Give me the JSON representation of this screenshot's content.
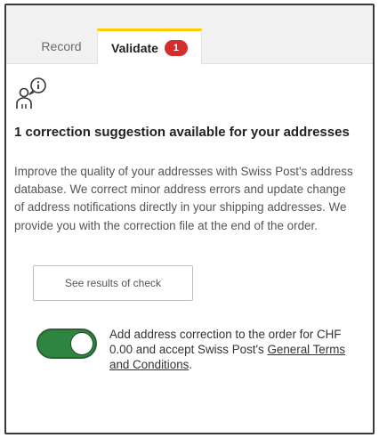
{
  "tabs": [
    {
      "label": "Record",
      "active": false
    },
    {
      "label": "Validate",
      "active": true,
      "badge": "1"
    }
  ],
  "colors": {
    "tab_accent": "#ffcc00",
    "badge": "#d42d2d",
    "toggle_on": "#2e8540"
  },
  "icon": "person-info-icon",
  "heading": "1 correction suggestion available for your addresses",
  "description": "Improve the quality of your addresses with Swiss Post's address database. We correct minor address errors and update change of address notifications directly in your shipping addresses. We provide you with the correction file at the end of the order.",
  "check_button_label": "See results of check",
  "toggle": {
    "on": true,
    "text_before_link": "Add address correction to the order for CHF 0.00 and accept Swiss Post's ",
    "link_text": "General Terms and Conditions",
    "text_after_link": "."
  }
}
